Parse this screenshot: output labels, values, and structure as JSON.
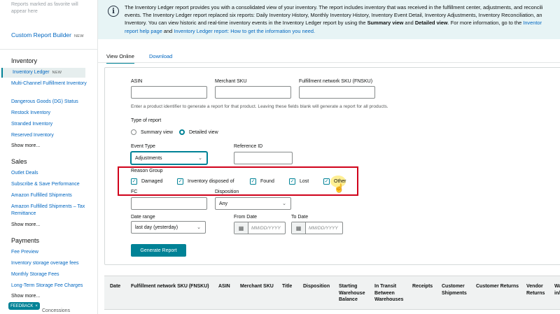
{
  "sidebar": {
    "favorites_note": "Reports marked as favorite will appear here",
    "custom_report_builder": "Custom Report Builder",
    "new_label": "NEW",
    "inventory_heading": "Inventory",
    "inventory_items": [
      "Inventory Ledger",
      "Multi-Channel Fulfillment Inventory",
      "Dangerous Goods (DG) Status",
      "Restock Inventory",
      "Stranded Inventory",
      "Reserved Inventory"
    ],
    "show_more": "Show more...",
    "sales_heading": "Sales",
    "sales_items": [
      "Outlet Deals",
      "Subscribe & Save Performance",
      "Amazon Fulfilled Shipments",
      "Amazon Fulfilled Shipments – Tax Remittance"
    ],
    "payments_heading": "Payments",
    "payments_items": [
      "Fee Preview",
      "Inventory storage overage fees",
      "Monthly Storage Fees",
      "Long-Term Storage Fee Charges"
    ],
    "partial_heading": "Concessions",
    "feedback": "FEEDBACK"
  },
  "banner": {
    "line1": "The Inventory Ledger report provides you with a consolidated view of your inventory. The report includes inventory that was received in the fulfillment center, adjustments, and reconcili",
    "line2": "events. The Inventory Ledger report replaced six reports: Daily Inventory History, Monthly Inventory History, Inventory Event Detail, Inventory Adjustments, Inventory Reconciliation, an",
    "line3a": "Inventory. You can view historic and real-time inventory events in the Inventory Ledger report by using the ",
    "summary_view": "Summary view",
    "and": " and ",
    "detailed_view": "Detailed view",
    "line3b": ". For more information, go to the ",
    "line3_link": "Inventor",
    "line4_link1": "report help page",
    "line4_and": " and ",
    "line4_link2": "Inventory Ledger report: How to get the information you need."
  },
  "tabs": {
    "view_online": "View Online",
    "download": "Download"
  },
  "form": {
    "asin_label": "ASIN",
    "sku_label": "Merchant SKU",
    "fnsku_label": "Fulfillment network SKU (FNSKU)",
    "help_text": "Enter a product identifier to generate a report for that product. Leaving these fields blank will generate a report for all products.",
    "type_label": "Type of report",
    "summary_option": "Summary view",
    "detailed_option": "Detailed view",
    "selected_type": "Detailed view",
    "event_type_label": "Event Type",
    "event_type_value": "Adjustments",
    "reference_id_label": "Reference ID",
    "reason_group_label": "Reason Group",
    "reasons": [
      {
        "label": "Damaged",
        "checked": true
      },
      {
        "label": "Inventory disposed of",
        "checked": true
      },
      {
        "label": "Found",
        "checked": true
      },
      {
        "label": "Lost",
        "checked": true
      },
      {
        "label": "Other",
        "checked": true
      }
    ],
    "fc_label": "FC",
    "disposition_label": "Disposition",
    "disposition_value": "Any",
    "date_range_label": "Date range",
    "date_range_value": "last day (yesterday)",
    "from_date_label": "From Date",
    "to_date_label": "To Date",
    "date_placeholder": "MM/DD/YYYY",
    "generate_button": "Generate Report"
  },
  "table": {
    "columns": [
      "Date",
      "Fulfillment network SKU (FNSKU)",
      "ASIN",
      "Merchant SKU",
      "Title",
      "Disposition",
      "Starting Warehouse Balance",
      "In Transit Between Warehouses",
      "Receipts",
      "Customer Shipments",
      "Customer Returns",
      "Vendor Returns",
      "Wa in/o"
    ]
  },
  "colors": {
    "accent": "#008296",
    "link": "#0066c0",
    "banner_bg": "#e7f4f5",
    "annotation_red": "#d0021b"
  }
}
